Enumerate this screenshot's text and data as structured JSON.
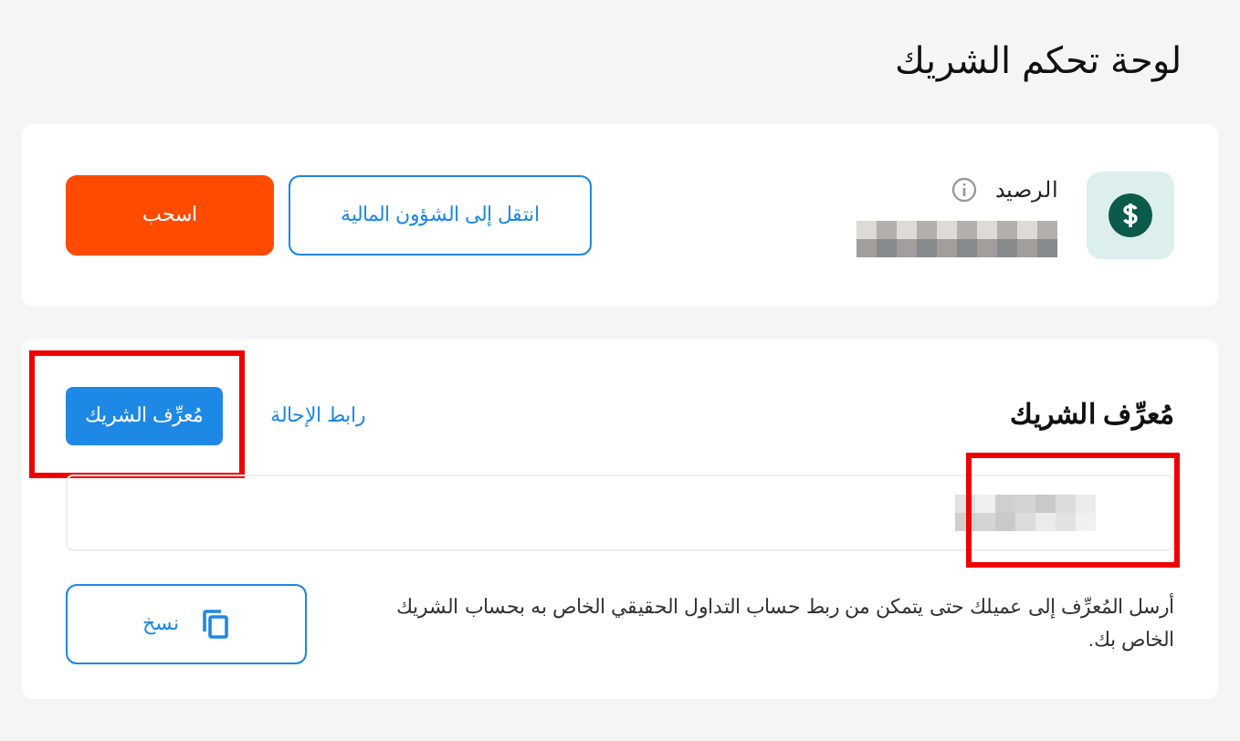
{
  "page_title": "لوحة تحكم الشريك",
  "balance": {
    "label": "الرصيد",
    "actions": [
      {
        "label": "انتقل إلى الشؤون المالية",
        "kind": "outline"
      },
      {
        "label": "اسحب",
        "kind": "solid"
      }
    ]
  },
  "partner_id": {
    "title": "مُعرِّف الشريك",
    "tabs": [
      {
        "label": "رابط الإحالة",
        "selected": false
      },
      {
        "label": "مُعرِّف الشريك",
        "selected": true
      }
    ],
    "description": "أرسل المُعرِّف إلى عميلك حتى يتمكن من ربط حساب التداول الحقيقي الخاص به بحساب الشريك الخاص بك.",
    "copy_button": "نسخ"
  }
}
